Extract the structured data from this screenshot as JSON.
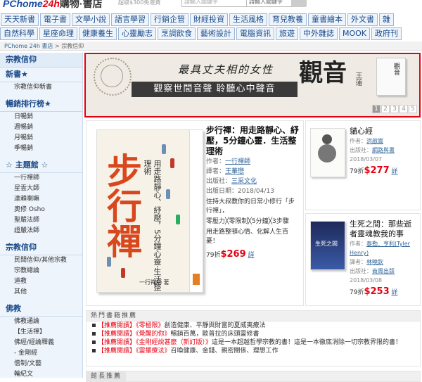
{
  "header": {
    "logo_main": "PChome",
    "logo_num": "24h",
    "logo_book": "購物·書店",
    "shipping": "超取$300免運費",
    "search_placeholder": "請輸入關鍵字",
    "search_select": "請輸入關鍵字"
  },
  "tabs": {
    "row1": [
      "天天新書",
      "電子書",
      "文學小說",
      "語言學習",
      "行銷企管",
      "財經投資",
      "生活風格",
      "育兒教養",
      "童書繪本",
      "外文書",
      "雜"
    ],
    "row2": [
      "自然科學",
      "星座命理",
      "健康養生",
      "心靈勵志",
      "烹調飲食",
      "藝術設計",
      "電腦資訊",
      "旅遊",
      "中外雜誌",
      "MOOK",
      "政府刊"
    ]
  },
  "breadcrumb": {
    "home": "PChome 24h 書店",
    "sep": " > ",
    "current": "宗教信仰"
  },
  "sidebar": {
    "title": "宗教信仰",
    "new_title": "新書★",
    "new_items": [
      "宗教信仰新書"
    ],
    "rank_title": "暢銷排行榜★",
    "rank_items": [
      "日暢銷",
      "週暢銷",
      "月暢銷",
      "季暢銷"
    ],
    "topic_title": "☆ 主題館 ☆",
    "topic_items": [
      "一行禪師",
      "星雲大師",
      "達賴喇嘛",
      "奧修 Osho",
      "聖嚴法師",
      "證嚴法師"
    ],
    "religion_title": "宗教信仰",
    "religion_items": [
      "民間信仰/其他宗教",
      "宗教總論",
      "道教",
      "其他"
    ],
    "buddhism_title": "佛教",
    "buddhism_items": [
      "佛教通論",
      "【生活禪】",
      "佛經/經論釋義",
      "- 金剛經",
      "僧制/文藝",
      "輪紀文"
    ]
  },
  "banner": {
    "line1": "最具丈夫相的女性",
    "strip": "觀察世間音聲 聆聽心中聲音",
    "big": "觀音",
    "sub": "王蓮",
    "book": "觀音",
    "pages": [
      "1",
      "2",
      "3",
      "4",
      "5"
    ],
    "active_page": "1"
  },
  "feature": {
    "cover_title": "步行禪",
    "cover_sub": "用走路靜心、紓壓，5分鐘心靈·生活整理術",
    "cover_author": "一行禪師 著",
    "title": "步行禪：用走路靜心、紓壓，5分鐘心靈．生活整理術",
    "author_label": "作者：",
    "author": "一行禪師",
    "translator_label": "譯者：",
    "translator": "王華懋",
    "publisher_label": "出版社：",
    "publisher": "三采文化",
    "date": "出版日期：2018/04/13",
    "desc1": "住持大叔教你的日常小修行「步行禪」，",
    "desc2": "零壓力╳零限制╳5分鐘╳3步驟",
    "desc3": "用走路整頓心情、化解人生百憂！",
    "discount": "79折",
    "price": "$269",
    "detail": "詳"
  },
  "book2": {
    "title": "貓心經",
    "author_label": "作者：",
    "author": "洪啟嵩",
    "publisher_label": "出版社：",
    "publisher": "網路與書",
    "date": "2018/03/07",
    "discount": "79折",
    "price": "$277",
    "detail": "詳"
  },
  "book3": {
    "title": "生死之間：那些逝者靈魂教我的事",
    "author_label": "作者：",
    "author": "泰勒．亨利(Tyler Henry)",
    "translator_label": "譯者：",
    "translator": "林曉欽",
    "publisher_label": "出版社：",
    "publisher": "商周出版",
    "date": "2018/03/08",
    "discount": "79折",
    "price": "$253",
    "detail": "詳",
    "cover_text": "生死之間"
  },
  "hot": {
    "heading": "熱門書籍推薦",
    "items": [
      {
        "tag": "【推薦閱讀】",
        "book": "《零極限》",
        "text": "創造健康、平靜與財富的夏威夷療法"
      },
      {
        "tag": "【推薦閱讀】",
        "book": "《覺醒的你》",
        "text": "暢銷百萬，歐普拉的床頭靈修書"
      },
      {
        "tag": "【推薦閱讀】",
        "book": "《金剛經說甚麼（新訂版）》",
        "text": "這是一本超越哲學宗教的書！這是一本徹底消除一切宗教界限的書！"
      },
      {
        "tag": "【推薦閱讀】",
        "book": "《靈擺療法》",
        "text": "召喚健康、金錢、親密關係、理想工作"
      }
    ]
  },
  "ednote": "館長推薦",
  "colors": {
    "accent": "#e60012",
    "link": "#336699",
    "nav": "#1a4a8a"
  }
}
